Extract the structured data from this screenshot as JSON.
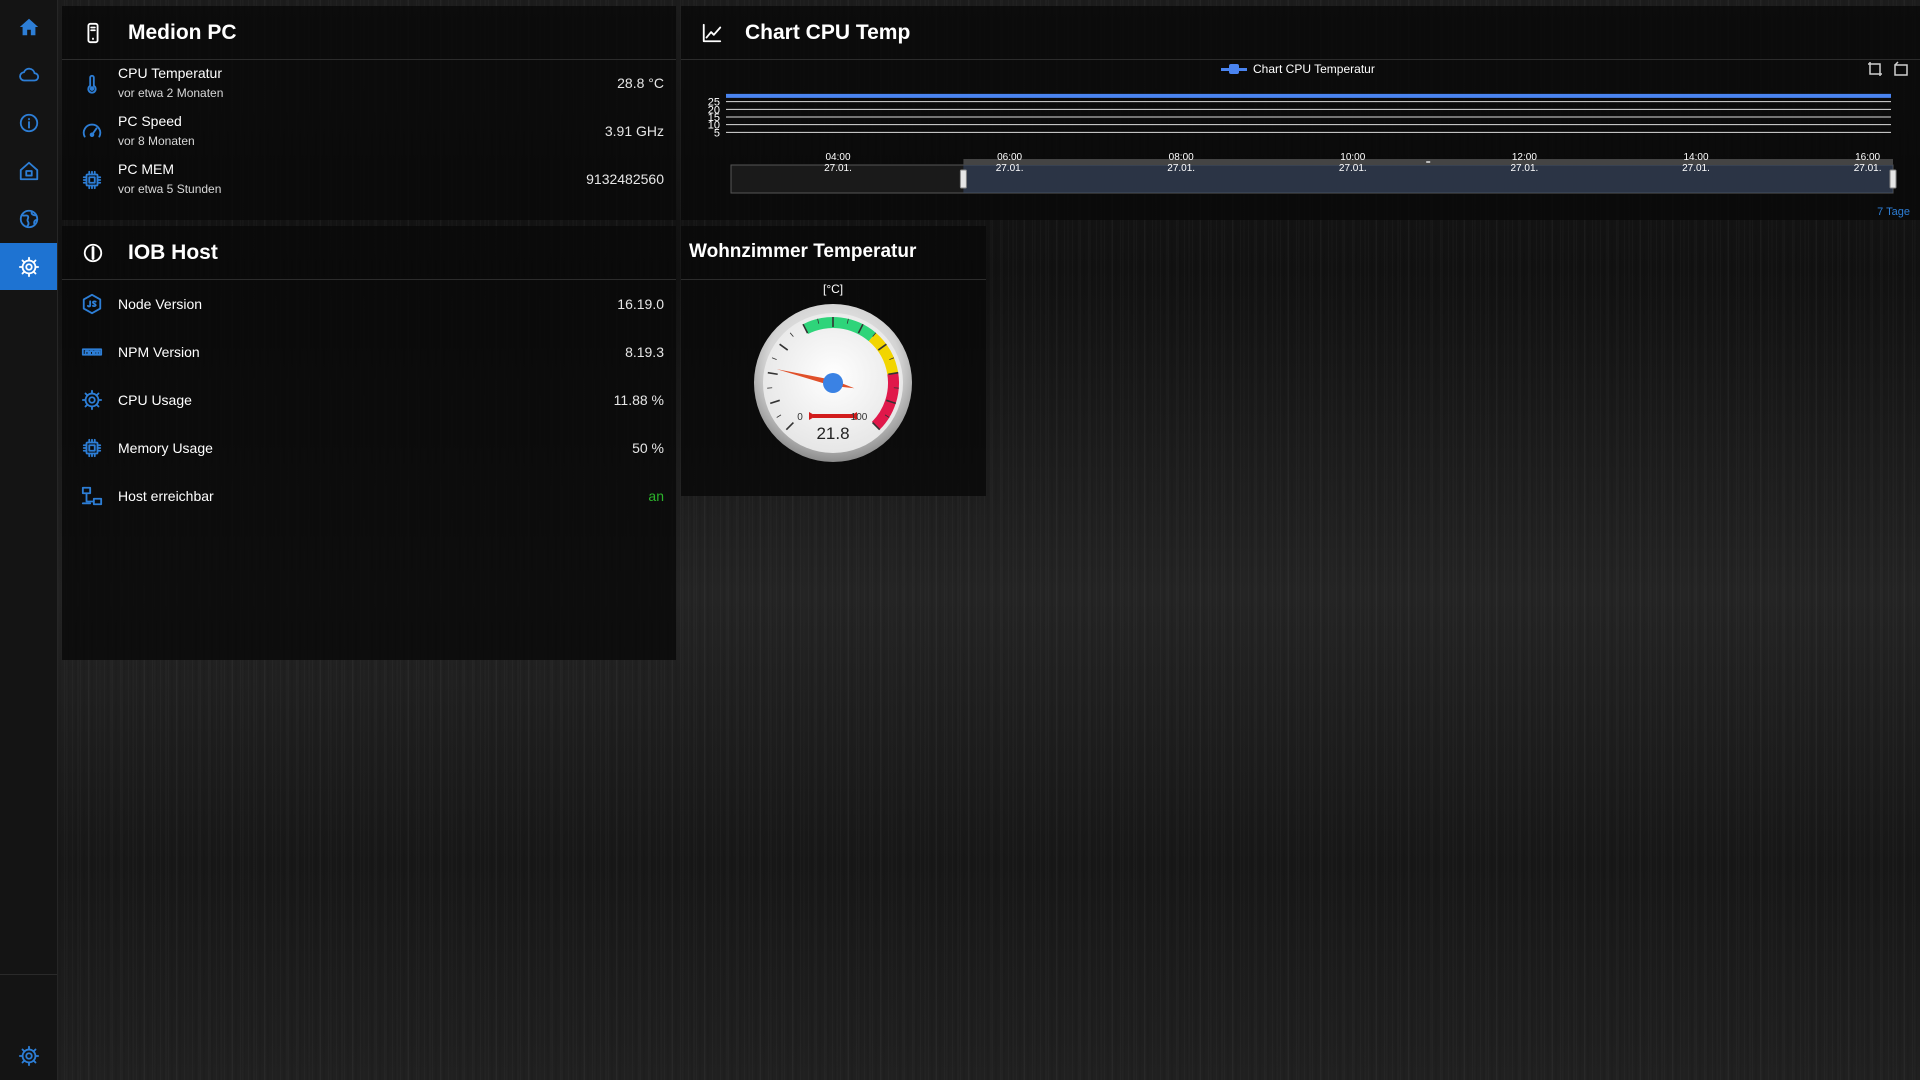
{
  "sidebar": {
    "items": [
      {
        "name": "home",
        "icon": "home-icon"
      },
      {
        "name": "cloud",
        "icon": "cloud-icon"
      },
      {
        "name": "info",
        "icon": "info-icon"
      },
      {
        "name": "house",
        "icon": "house-icon"
      },
      {
        "name": "globe",
        "icon": "globe-icon"
      },
      {
        "name": "settings",
        "icon": "gear-icon",
        "active": true
      }
    ],
    "bottom_icon": "gear-icon"
  },
  "medion": {
    "title": "Medion PC",
    "rows": [
      {
        "label": "CPU Temperatur",
        "sub": "vor etwa 2 Monaten",
        "value": "28.8 °C"
      },
      {
        "label": "PC Speed",
        "sub": "vor 8 Monaten",
        "value": "3.91 GHz"
      },
      {
        "label": "PC MEM",
        "sub": "vor etwa 5 Stunden",
        "value": "9132482560"
      }
    ]
  },
  "iob": {
    "title": "IOB Host",
    "rows": [
      {
        "label": "Node Version",
        "value": "16.19.0"
      },
      {
        "label": "NPM Version",
        "value": "8.19.3"
      },
      {
        "label": "CPU Usage",
        "value": "11.88 %"
      },
      {
        "label": "Memory Usage",
        "value": "50 %"
      },
      {
        "label": "Host erreichbar",
        "value": "an",
        "value_color": "#2bb32b"
      }
    ]
  },
  "chart_card": {
    "title": "Chart CPU Temp",
    "range_label": "7 Tage"
  },
  "chart_data": {
    "type": "line",
    "title": "",
    "series": [
      {
        "name": "Chart CPU Temperatur",
        "color": "#4a84f0",
        "values": [
          28.8,
          28.8
        ]
      }
    ],
    "x": [
      "27.01. 02:40",
      "27.01. 16:40"
    ],
    "y_ticks": [
      "25",
      "20",
      "15",
      "10",
      "5"
    ],
    "x_ticks": [
      {
        "time": "04:00",
        "date": "27.01."
      },
      {
        "time": "06:00",
        "date": "27.01."
      },
      {
        "time": "08:00",
        "date": "27.01."
      },
      {
        "time": "10:00",
        "date": "27.01."
      },
      {
        "time": "12:00",
        "date": "27.01."
      },
      {
        "time": "14:00",
        "date": "27.01."
      },
      {
        "time": "16:00",
        "date": "27.01."
      }
    ],
    "ylim": [
      0,
      30
    ],
    "grid": true,
    "legend": "top-center",
    "zoom_window": [
      0.2,
      1.0
    ]
  },
  "gauge": {
    "title": "Wohnzimmer Temperatur",
    "unit": "[°C]",
    "value": 21.8,
    "value_text": "21.8",
    "min": 0,
    "max": 100,
    "min_label": "0",
    "max_label": "100",
    "zones": [
      {
        "from": 40,
        "to": 65,
        "color": "#2ed47a"
      },
      {
        "from": 65,
        "to": 80,
        "color": "#f2d500"
      },
      {
        "from": 80,
        "to": 100,
        "color": "#e0184a"
      }
    ]
  }
}
